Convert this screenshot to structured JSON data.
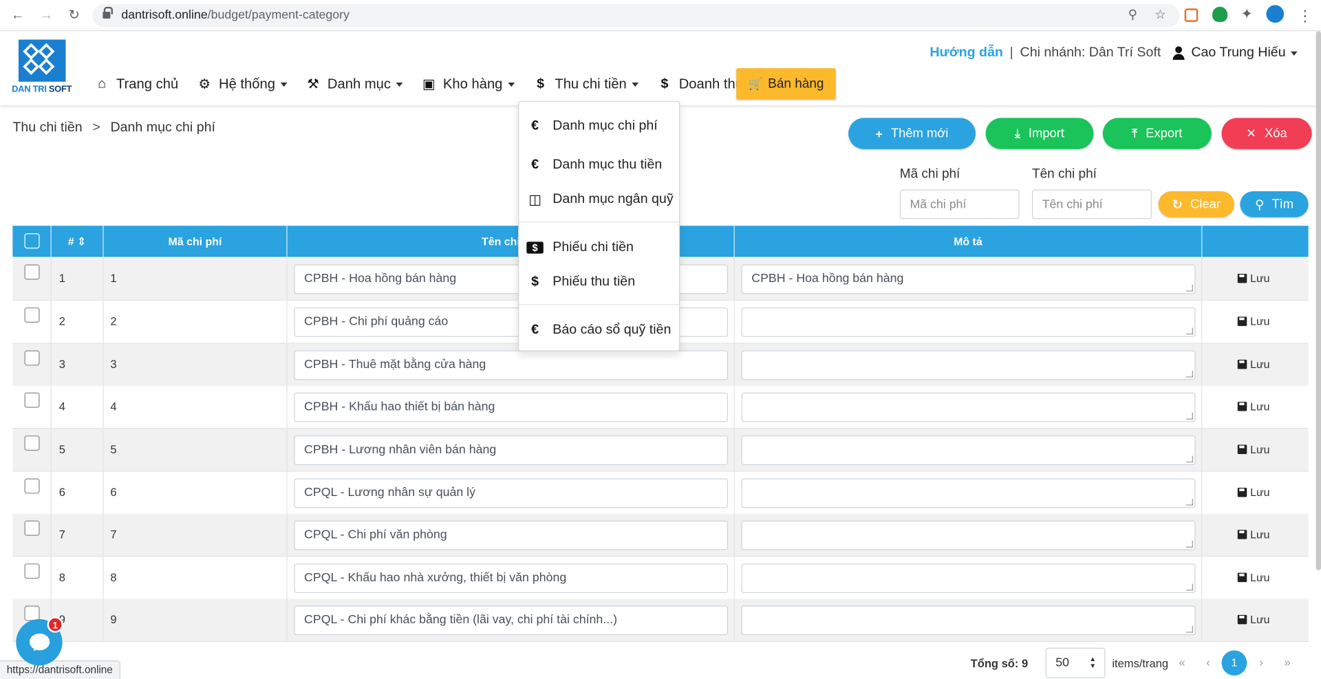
{
  "browser": {
    "url_host": "dantrisoft.online",
    "url_path": "/budget/payment-category",
    "status_url": "https://dantrisoft.online"
  },
  "header": {
    "logo_text_1": "DAN TRI",
    "logo_text_2": "SOFT",
    "help": "Hướng dẫn",
    "separator": "|",
    "branch": "Chi nhánh: Dân Trí Soft",
    "user": "Cao Trung Hiếu"
  },
  "menu": {
    "home": "Trang chủ",
    "system": "Hệ thống",
    "category": "Danh mục",
    "warehouse": "Kho hàng",
    "finance": "Thu chi tiền",
    "revenue": "Doanh thu",
    "sell": "Bán hàng"
  },
  "dropdown": {
    "items": [
      {
        "label": "Danh mục chi phí",
        "icon": "euro-icon"
      },
      {
        "label": "Danh mục thu tiền",
        "icon": "euro-icon"
      },
      {
        "label": "Danh mục ngân quỹ",
        "icon": "briefcase-icon"
      },
      {
        "label": "Phiếu chi tiền",
        "icon": "money-bill-icon"
      },
      {
        "label": "Phiếu thu tiền",
        "icon": "dollar-icon"
      },
      {
        "label": "Báo cáo sổ quỹ tiền",
        "icon": "euro-icon"
      }
    ]
  },
  "breadcrumb": {
    "parent": "Thu chi tiền",
    "separator": ">",
    "current": "Danh mục chi phí"
  },
  "actions": {
    "add": "Thêm mới",
    "import": "Import",
    "export": "Export",
    "delete": "Xóa"
  },
  "filters": {
    "code_label": "Mã chi phí",
    "code_placeholder": "Mã chi phí",
    "name_label": "Tên chi phí",
    "name_placeholder": "Tên chi phí",
    "clear": "Clear",
    "search": "Tìm"
  },
  "table": {
    "headers": {
      "index": "#",
      "code": "Mã chi phí",
      "name": "Tên chi phí",
      "description": "Mô tả"
    },
    "save_label": "Lưu",
    "rows": [
      {
        "index": "1",
        "code": "1",
        "name": "CPBH - Hoa hồng bán hàng",
        "description": "CPBH - Hoa hồng bán hàng"
      },
      {
        "index": "2",
        "code": "2",
        "name": "CPBH - Chi phí quảng cáo",
        "description": ""
      },
      {
        "index": "3",
        "code": "3",
        "name": "CPBH - Thuê mặt bằng cửa hàng",
        "description": ""
      },
      {
        "index": "4",
        "code": "4",
        "name": "CPBH - Khấu hao thiết bị bán hàng",
        "description": ""
      },
      {
        "index": "5",
        "code": "5",
        "name": "CPBH - Lương nhân viên bán hàng",
        "description": ""
      },
      {
        "index": "6",
        "code": "6",
        "name": "CPQL - Lương nhân sự quản lý",
        "description": ""
      },
      {
        "index": "7",
        "code": "7",
        "name": "CPQL - Chi phí văn phòng",
        "description": ""
      },
      {
        "index": "8",
        "code": "8",
        "name": "CPQL - Khấu hao nhà xưởng, thiết bị văn phòng",
        "description": ""
      },
      {
        "index": "9",
        "code": "9",
        "name": "CPQL - Chi phí khác bằng tiền (lãi vay, chi phí tài chính...)",
        "description": ""
      }
    ]
  },
  "pagination": {
    "total": "Tổng số: 9",
    "per_page": "50",
    "items_label": "items/trang",
    "first": "«",
    "prev": "‹",
    "current": "1",
    "next": "›",
    "last": "»"
  },
  "chat": {
    "badge": "1"
  },
  "colors": {
    "primary": "#2aa3e0",
    "success": "#1bc35b",
    "danger": "#f23e55",
    "warning": "#fcb92c"
  }
}
